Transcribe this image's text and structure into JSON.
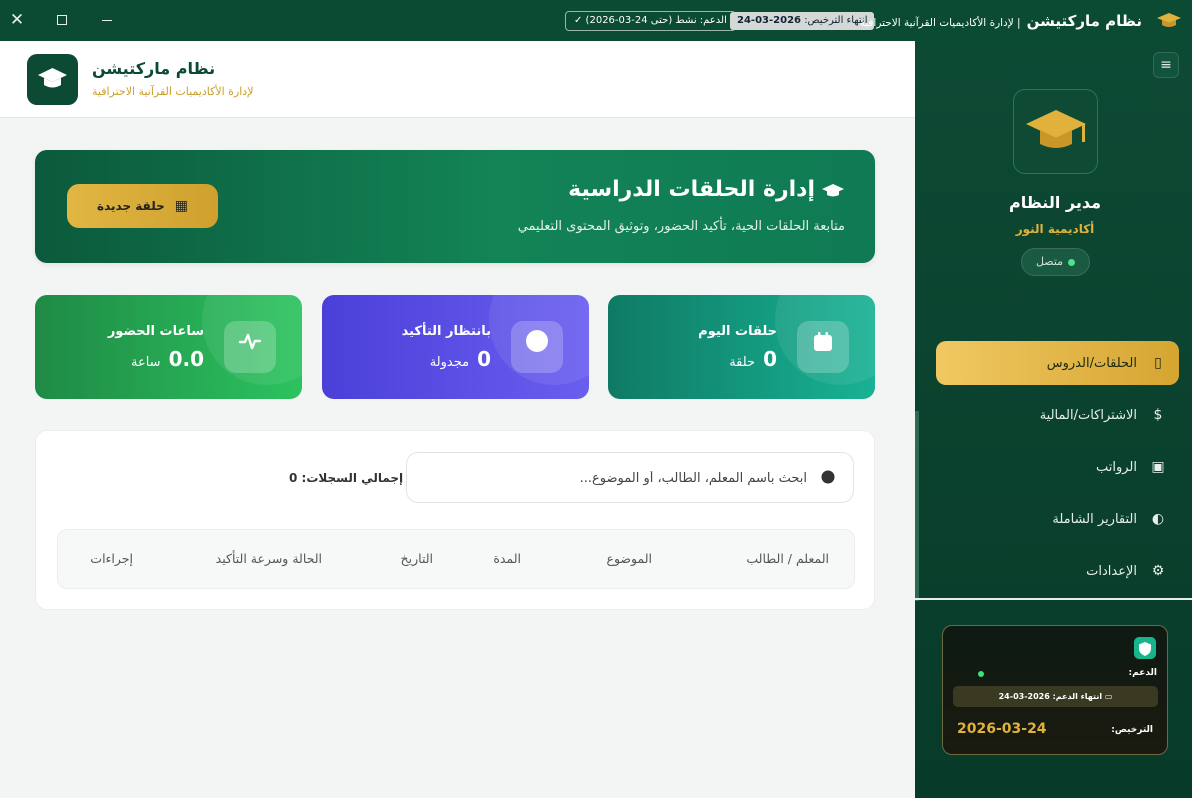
{
  "titlebar": {
    "app_name": "نظام ماركتيشن",
    "app_tagline": "| لإدارة الأكاديميات القرآنية الاحترافية",
    "license_label": "انتهاء الترخيص:",
    "license_date": "2026-03-24",
    "support_text": "الدعم: نشط (حتى 24-03-2026) ✓",
    "close_glyph": "✕"
  },
  "header": {
    "app_name": "نظام ماركتيشن",
    "subtitle": "لإدارة الأكاديميات القرآنية الاحترافية"
  },
  "banner": {
    "title": "إدارة الحلقات الدراسية",
    "subtitle": "متابعة الحلقات الحية، تأكيد الحضور، وتوثيق المحتوى التعليمي",
    "new_button": "حلقة جديدة"
  },
  "stats": [
    {
      "label": "حلقات اليوم",
      "value": "0",
      "unit": "حلقة",
      "icon": "calendar-icon"
    },
    {
      "label": "بانتظار التأكيد",
      "value": "0",
      "unit": "مجدولة",
      "icon": "pending-circle-icon"
    },
    {
      "label": "ساعات الحضور",
      "value": "0.0",
      "unit": "ساعة",
      "icon": "activity-icon"
    }
  ],
  "records": {
    "search_placeholder": "ابحث باسم المعلم، الطالب، أو الموضوع...",
    "total_label": "إجمالي السجلات:",
    "total_value": "0",
    "columns": [
      "المعلم / الطالب",
      "الموضوع",
      "المدة",
      "التاريخ",
      "الحالة وسرعة التأكيد",
      "إجراءات"
    ]
  },
  "sidebar": {
    "toggle_glyph": "≡",
    "user_name": "مدير النظام",
    "academy": "أكاديمية النور",
    "status": "متصل",
    "items": [
      {
        "label": "الحلقات/الدروس",
        "icon": "book-icon",
        "glyph": "▯",
        "active": true
      },
      {
        "label": "الاشتراكات/المالية",
        "icon": "dollar-icon",
        "glyph": "$",
        "active": false
      },
      {
        "label": "الرواتب",
        "icon": "wallet-icon",
        "glyph": "▣",
        "active": false
      },
      {
        "label": "التقارير الشاملة",
        "icon": "pie-chart-icon",
        "glyph": "◐",
        "active": false
      },
      {
        "label": "الإعدادات",
        "icon": "gear-icon",
        "glyph": "⚙",
        "active": false
      }
    ],
    "license_card": {
      "support_label": "الدعم:",
      "support_end": "انتهاء الدعم: 2026-03-24",
      "license_label": "الترخيص:",
      "license_value": "2026-03-24"
    }
  },
  "colors": {
    "primary": "#0d4a34",
    "accent": "#e0b23c",
    "today_card": "#18b294",
    "pending_card": "#5a4fe6",
    "hours_card": "#2cc35f"
  }
}
